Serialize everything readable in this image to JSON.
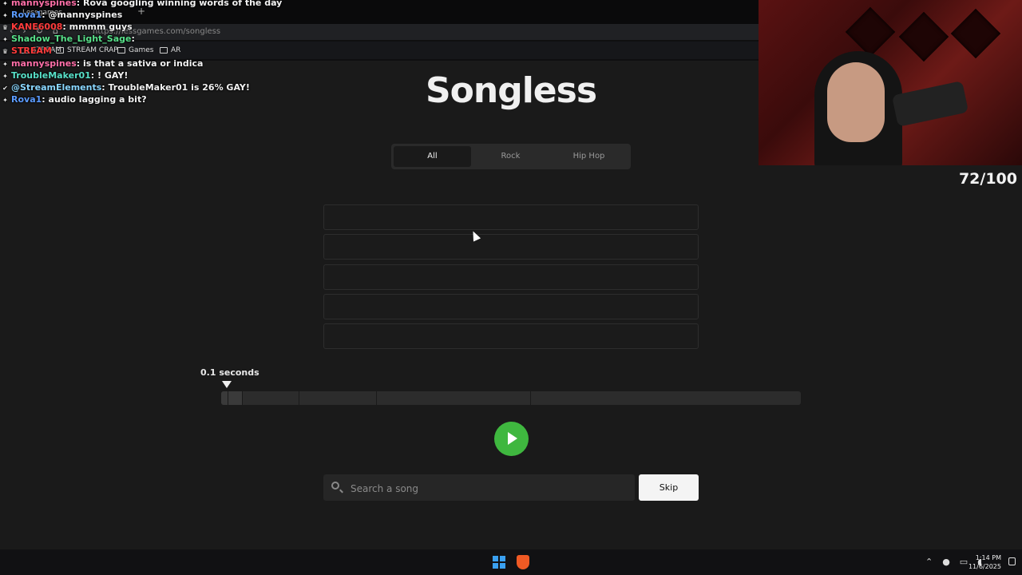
{
  "browser": {
    "tab_title": "Lessgames",
    "url": "https://lessgames.com/songless",
    "bookmarks": [
      "STREAM",
      "STREAM CRAP",
      "Games",
      "AR"
    ]
  },
  "chat": [
    {
      "user": "mannyspines",
      "color": "#ff6fa8",
      "text": "Rova googling winning words of the day"
    },
    {
      "user": "Rova1",
      "color": "#5b9bff",
      "text": "@mannyspines"
    },
    {
      "user": "KANE6008",
      "color": "#ff3b3b",
      "text": "mmmm guys"
    },
    {
      "user": "Shadow_The_Light_Sage",
      "color": "#58e08a",
      "text": ""
    },
    {
      "user": "STREAM",
      "color": "#ff3b3b",
      "text": ""
    },
    {
      "user": "mannyspines",
      "color": "#ff6fa8",
      "text": "is that a sativa or indica"
    },
    {
      "user": "TroubleMaker01",
      "color": "#58e0c8",
      "text": "! GAY!"
    },
    {
      "user": "@StreamElements",
      "color": "#8ad7ff",
      "text": "TroubleMaker01 is 26% GAY!"
    },
    {
      "user": "Rova1",
      "color": "#5b9bff",
      "text": "audio lagging a bit?"
    }
  ],
  "overlay": {
    "counter": "72/100"
  },
  "game": {
    "title": "Songless",
    "genres": [
      {
        "label": "All",
        "active": true
      },
      {
        "label": "Rock",
        "active": false
      },
      {
        "label": "Hip Hop",
        "active": false
      }
    ],
    "guess_slots": 5,
    "seconds_label": "0.1 seconds",
    "search_placeholder": "Search a song",
    "skip_label": "Skip"
  },
  "taskbar": {
    "time": "1:14 PM",
    "date": "11/6/2025"
  },
  "colors": {
    "play": "#3fb73f",
    "background": "#1a1a1a"
  }
}
